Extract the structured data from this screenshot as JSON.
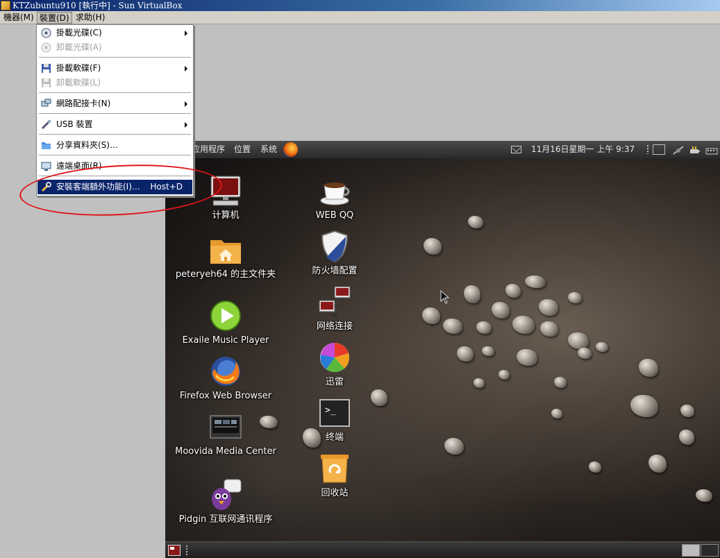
{
  "window": {
    "title": "KTZubuntu910 [執行中] - Sun VirtualBox"
  },
  "menubar": {
    "items": [
      "機器(M)",
      "裝置(D)",
      "求助(H)"
    ],
    "open_index": 1
  },
  "devices_menu": {
    "items": [
      {
        "label": "掛載光碟(C)",
        "icon": "cd-icon",
        "submenu": true,
        "disabled": false
      },
      {
        "label": "卸載光碟(A)",
        "icon": "cd-icon",
        "submenu": false,
        "disabled": true
      },
      {
        "label": "掛載軟碟(F)",
        "icon": "floppy-icon",
        "submenu": true,
        "disabled": false
      },
      {
        "label": "卸載軟碟(L)",
        "icon": "floppy-icon",
        "submenu": false,
        "disabled": true
      },
      {
        "label": "網路配接卡(N)",
        "icon": "network-icon",
        "submenu": true,
        "disabled": false
      },
      {
        "label": "USB 裝置",
        "icon": "usb-icon",
        "submenu": true,
        "disabled": false
      },
      {
        "label": "分享資料夾(S)…",
        "icon": "folder-icon",
        "submenu": false,
        "disabled": false
      },
      {
        "label": "遠端桌面(R)",
        "icon": "remote-desktop-icon",
        "submenu": false,
        "disabled": false
      },
      {
        "label": "安裝客端額外功能(I)…",
        "icon": "wrench-icon",
        "submenu": false,
        "disabled": false,
        "highlighted": true,
        "shortcut": "Host+D"
      }
    ]
  },
  "guest": {
    "panel": {
      "applications": "应用程序",
      "places": "位置",
      "system": "系统",
      "clock": "11月16日星期一 上午 9:37"
    },
    "desktop_icons": [
      {
        "label": "计算机",
        "icon": "computer-icon"
      },
      {
        "label": "peteryeh64 的主文件夹",
        "icon": "home-folder-icon"
      },
      {
        "label": "Exaile Music Player",
        "icon": "play-icon"
      },
      {
        "label": "Firefox Web Browser",
        "icon": "firefox-icon"
      },
      {
        "label": "Moovida Media Center",
        "icon": "media-center-icon"
      },
      {
        "label": "Pidgin 互联网通讯程序",
        "icon": "pidgin-icon"
      },
      {
        "label": "WEB QQ",
        "icon": "coffee-cup-icon"
      },
      {
        "label": "防火墙配置",
        "icon": "firewall-shield-icon"
      },
      {
        "label": "网络连接",
        "icon": "network-connections-icon"
      },
      {
        "label": "迅雷",
        "icon": "thunder-icon"
      },
      {
        "label": "终端",
        "icon": "terminal-icon"
      },
      {
        "label": "回收站",
        "icon": "trash-icon"
      }
    ],
    "terminal_prompt": ">_"
  },
  "colors": {
    "menu_highlight": "#0a246a",
    "annotation": "#e0141a",
    "titlebar": "#0a246a"
  }
}
